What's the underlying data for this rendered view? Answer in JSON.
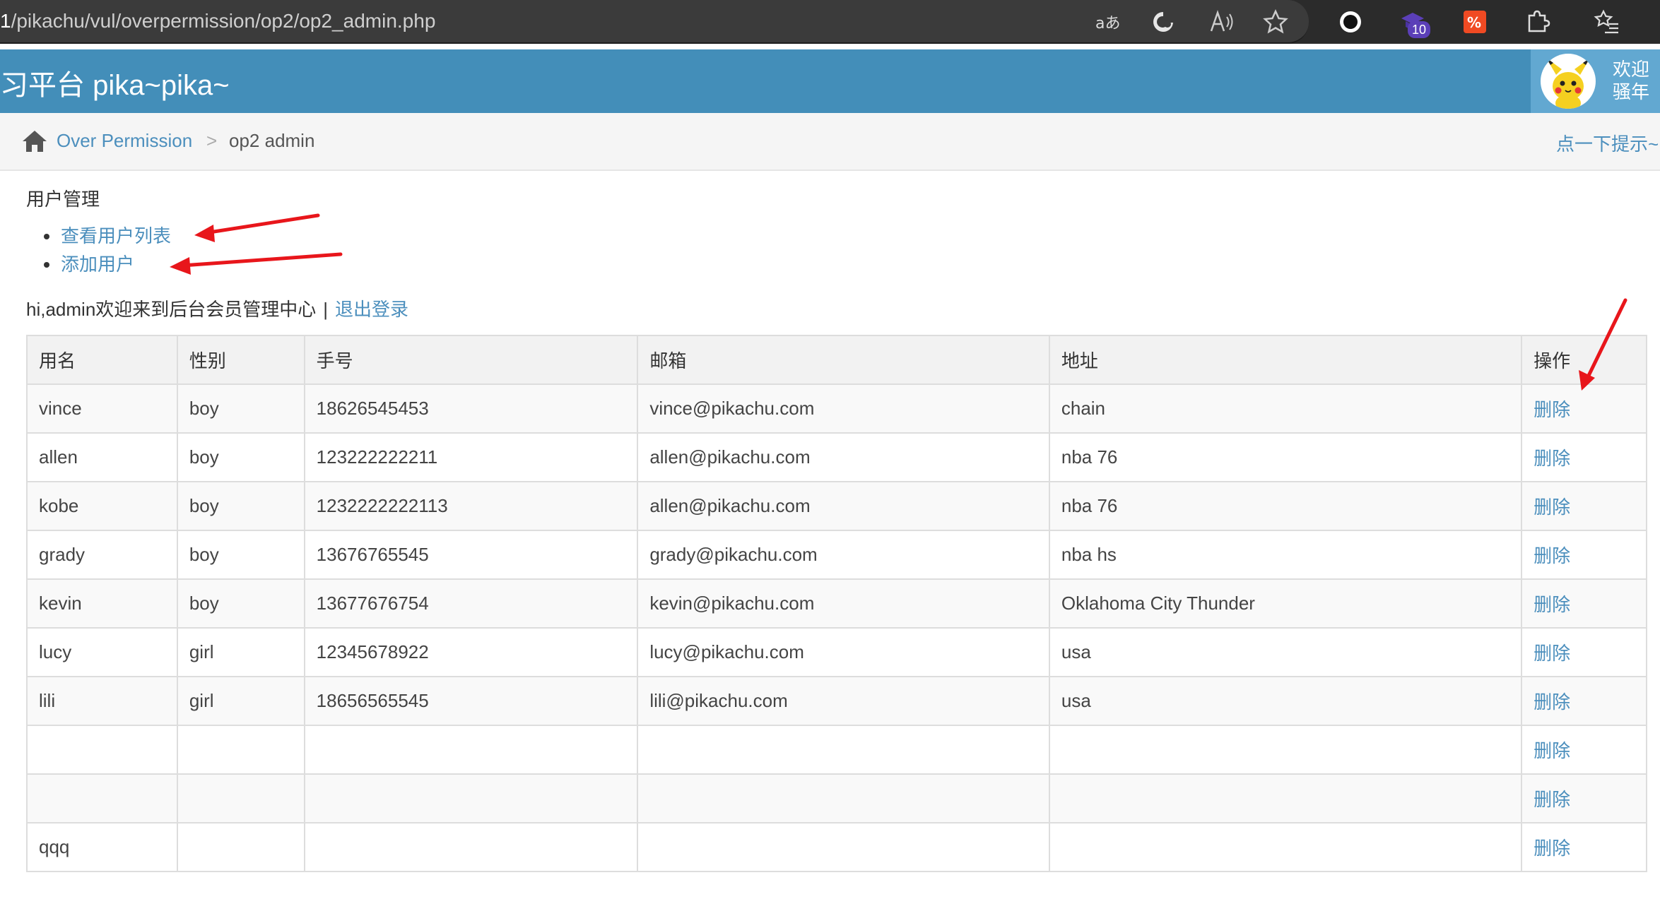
{
  "browser": {
    "url_prefix": "1",
    "url_rest": "/pikachu/vul/overpermission/op2/op2_admin.php",
    "extension_badge": "10",
    "icons": [
      "translate-icon",
      "edge-refresh-icon",
      "read-aloud-icon",
      "favorite-star-icon",
      "record-extension-icon",
      "extension-hat-icon",
      "translate-extension-icon",
      "extensions-puzzle-icon",
      "favorites-list-icon"
    ]
  },
  "header": {
    "site_title": "习平台 pika~pika~",
    "welcome_line1": "欢迎",
    "welcome_line2": "骚年"
  },
  "breadcrumb": {
    "parent": "Over Permission",
    "separator": ">",
    "current": "op2 admin",
    "hint": "点一下提示~"
  },
  "content": {
    "section_title": "用户管理",
    "menu": [
      "查看用户列表",
      "添加用户"
    ],
    "greeting": "hi,admin欢迎来到后台会员管理中心",
    "greeting_sep": "|",
    "logout": "退出登录"
  },
  "table": {
    "headers": [
      "用名",
      "性别",
      "手号",
      "邮箱",
      "地址",
      "操作"
    ],
    "rows": [
      {
        "name": "vince",
        "sex": "boy",
        "phone": "18626545453",
        "email": "vince@pikachu.com",
        "address": "chain",
        "action": "删除"
      },
      {
        "name": "allen",
        "sex": "boy",
        "phone": "123222222211",
        "email": "allen@pikachu.com",
        "address": "nba 76",
        "action": "删除"
      },
      {
        "name": "kobe",
        "sex": "boy",
        "phone": "1232222222113",
        "email": "allen@pikachu.com",
        "address": "nba 76",
        "action": "删除"
      },
      {
        "name": "grady",
        "sex": "boy",
        "phone": "13676765545",
        "email": "grady@pikachu.com",
        "address": "nba hs",
        "action": "删除"
      },
      {
        "name": "kevin",
        "sex": "boy",
        "phone": "13677676754",
        "email": "kevin@pikachu.com",
        "address": "Oklahoma City Thunder",
        "action": "删除"
      },
      {
        "name": "lucy",
        "sex": "girl",
        "phone": "12345678922",
        "email": "lucy@pikachu.com",
        "address": "usa",
        "action": "删除"
      },
      {
        "name": "lili",
        "sex": "girl",
        "phone": "18656565545",
        "email": "lili@pikachu.com",
        "address": "usa",
        "action": "删除"
      },
      {
        "name": "",
        "sex": "",
        "phone": "",
        "email": "",
        "address": "",
        "action": "删除"
      },
      {
        "name": "",
        "sex": "",
        "phone": "",
        "email": "",
        "address": "",
        "action": "删除"
      },
      {
        "name": "qqq",
        "sex": "",
        "phone": "",
        "email": "",
        "address": "",
        "action": "删除"
      }
    ]
  },
  "annotation_color": "#e8161b",
  "colors": {
    "header_bg": "#438eb9",
    "link": "#4c8fbd"
  }
}
